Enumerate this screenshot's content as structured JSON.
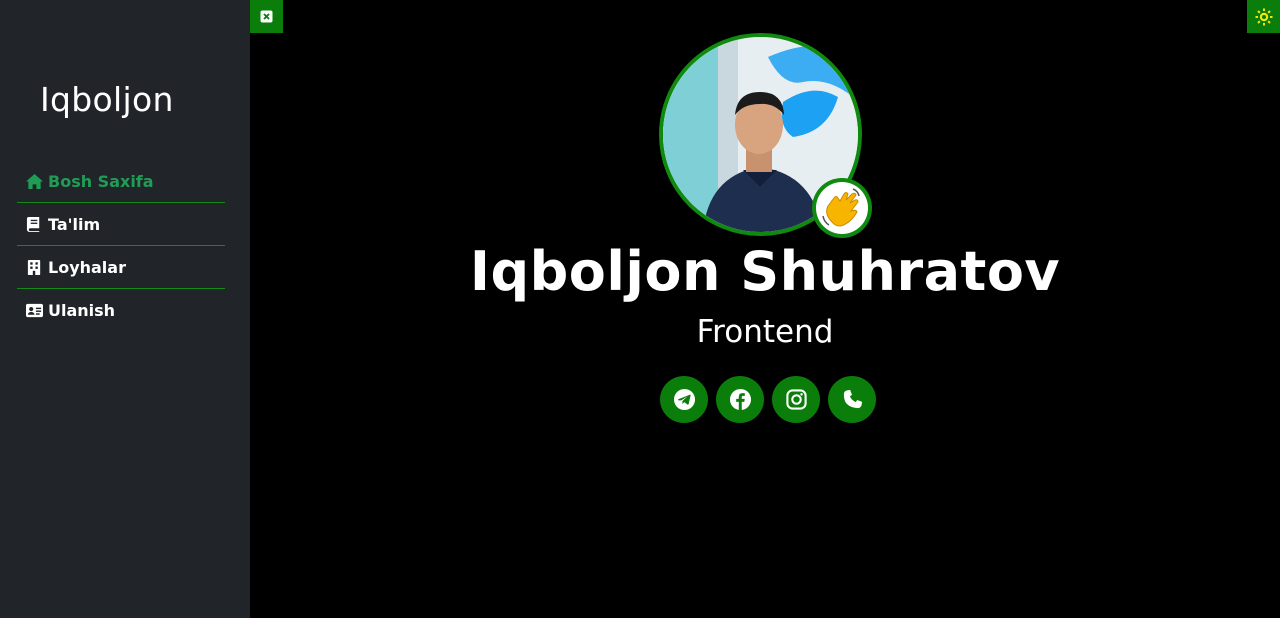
{
  "sidebar": {
    "brand": "Iqboljon",
    "items": [
      {
        "label": "Bosh Saxifa",
        "icon": "home-icon",
        "active": true
      },
      {
        "label": "Ta'lim",
        "icon": "book-icon",
        "active": false
      },
      {
        "label": "Loyhalar",
        "icon": "building-icon",
        "active": false
      },
      {
        "label": "Ulanish",
        "icon": "id-card-icon",
        "active": false
      }
    ]
  },
  "top_controls": {
    "close_icon": "close-icon",
    "theme_icon": "sun-icon"
  },
  "profile": {
    "name": "Iqboljon Shuhratov",
    "role": "Frontend",
    "avatar_icon": "profile-photo",
    "badge_icon": "waving-hand-icon"
  },
  "socials": [
    {
      "icon": "telegram-icon"
    },
    {
      "icon": "facebook-icon"
    },
    {
      "icon": "instagram-icon"
    },
    {
      "icon": "phone-icon"
    }
  ],
  "colors": {
    "accent": "#0a7d0a",
    "active_nav": "#1f9d55",
    "sidebar_bg": "#212529",
    "main_bg": "#000000"
  }
}
